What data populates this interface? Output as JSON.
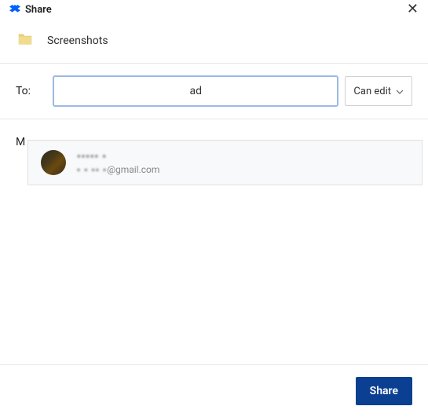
{
  "header": {
    "title": "Share"
  },
  "folder": {
    "name": "Screenshots"
  },
  "to": {
    "label": "To:",
    "input_value": "ad"
  },
  "permission": {
    "label": "Can edit"
  },
  "message": {
    "label_initial": "M"
  },
  "suggestion": {
    "name_blurred": "▪▪▪▪▪ ▪",
    "email_prefix_blurred": "▪ ▪ ▪▪ ▪",
    "email_suffix": "@gmail.com"
  },
  "footer": {
    "share_label": "Share"
  },
  "colors": {
    "primary": "#0b3f91",
    "input_border": "#9db9e4",
    "dropbox_blue": "#0061ff"
  }
}
